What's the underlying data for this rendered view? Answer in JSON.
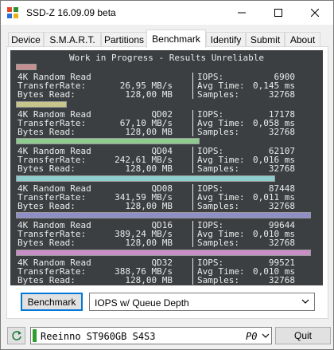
{
  "window": {
    "title": "SSD-Z 16.09.09 beta",
    "min": "—",
    "max": "☐",
    "close": "✕"
  },
  "tabs": [
    {
      "label": "Device"
    },
    {
      "label": "S.M.A.R.T."
    },
    {
      "label": "Partitions"
    },
    {
      "label": "Benchmark"
    },
    {
      "label": "Identify"
    },
    {
      "label": "Submit"
    },
    {
      "label": "About"
    }
  ],
  "benchmark": {
    "header": "Work in Progress - Results Unreliable",
    "rows": [
      {
        "test": "4K Random Read",
        "qd": "",
        "rate_label": "TransferRate:",
        "rate": "26,95 MB/s",
        "bytes_label": "Bytes Read:",
        "bytes": "128,00 MB",
        "iops_label": "IOPS:",
        "iops": "6900",
        "avg_label": "Avg Time:",
        "avg": "0,145 ms",
        "samples_label": "Samples:",
        "samples": "32768",
        "bar_color": "#c78f8f",
        "bar_fraction": 0.069
      },
      {
        "test": "4K Random Read",
        "qd": "QD02",
        "rate_label": "TransferRate:",
        "rate": "67,10 MB/s",
        "bytes_label": "Bytes Read:",
        "bytes": "128,00 MB",
        "iops_label": "IOPS:",
        "iops": "17178",
        "avg_label": "Avg Time:",
        "avg": "0,058 ms",
        "samples_label": "Samples:",
        "samples": "32768",
        "bar_color": "#c8c68b",
        "bar_fraction": 0.172
      },
      {
        "test": "4K Random Read",
        "qd": "QD04",
        "rate_label": "TransferRate:",
        "rate": "242,61 MB/s",
        "bytes_label": "Bytes Read:",
        "bytes": "128,00 MB",
        "iops_label": "IOPS:",
        "iops": "62107",
        "avg_label": "Avg Time:",
        "avg": "0,016 ms",
        "samples_label": "Samples:",
        "samples": "32768",
        "bar_color": "#8ecb8e",
        "bar_fraction": 0.62
      },
      {
        "test": "4K Random Read",
        "qd": "QD08",
        "rate_label": "TransferRate:",
        "rate": "341,59 MB/s",
        "bytes_label": "Bytes Read:",
        "bytes": "128,00 MB",
        "iops_label": "IOPS:",
        "iops": "87448",
        "avg_label": "Avg Time:",
        "avg": "0,011 ms",
        "samples_label": "Samples:",
        "samples": "32768",
        "bar_color": "#8ecdcd",
        "bar_fraction": 0.873
      },
      {
        "test": "4K Random Read",
        "qd": "QD16",
        "rate_label": "TransferRate:",
        "rate": "389,24 MB/s",
        "bytes_label": "Bytes Read:",
        "bytes": "128,00 MB",
        "iops_label": "IOPS:",
        "iops": "99644",
        "avg_label": "Avg Time:",
        "avg": "0,010 ms",
        "samples_label": "Samples:",
        "samples": "32768",
        "bar_color": "#8f8fc8",
        "bar_fraction": 0.995
      },
      {
        "test": "4K Random Read",
        "qd": "QD32",
        "rate_label": "TransferRate:",
        "rate": "388,76 MB/s",
        "bytes_label": "Bytes Read:",
        "bytes": "128,00 MB",
        "iops_label": "IOPS:",
        "iops": "99521",
        "avg_label": "Avg Time:",
        "avg": "0,010 ms",
        "samples_label": "Samples:",
        "samples": "32768",
        "bar_color": "#c88fc6",
        "bar_fraction": 0.994
      }
    ],
    "button_label": "Benchmark",
    "mode_selected": "IOPS w/ Queue Depth"
  },
  "footer": {
    "refresh_icon": "refresh-icon",
    "drive_name": "Reeinno ST960GB S4S3",
    "drive_port": "P0",
    "quit_label": "Quit"
  }
}
